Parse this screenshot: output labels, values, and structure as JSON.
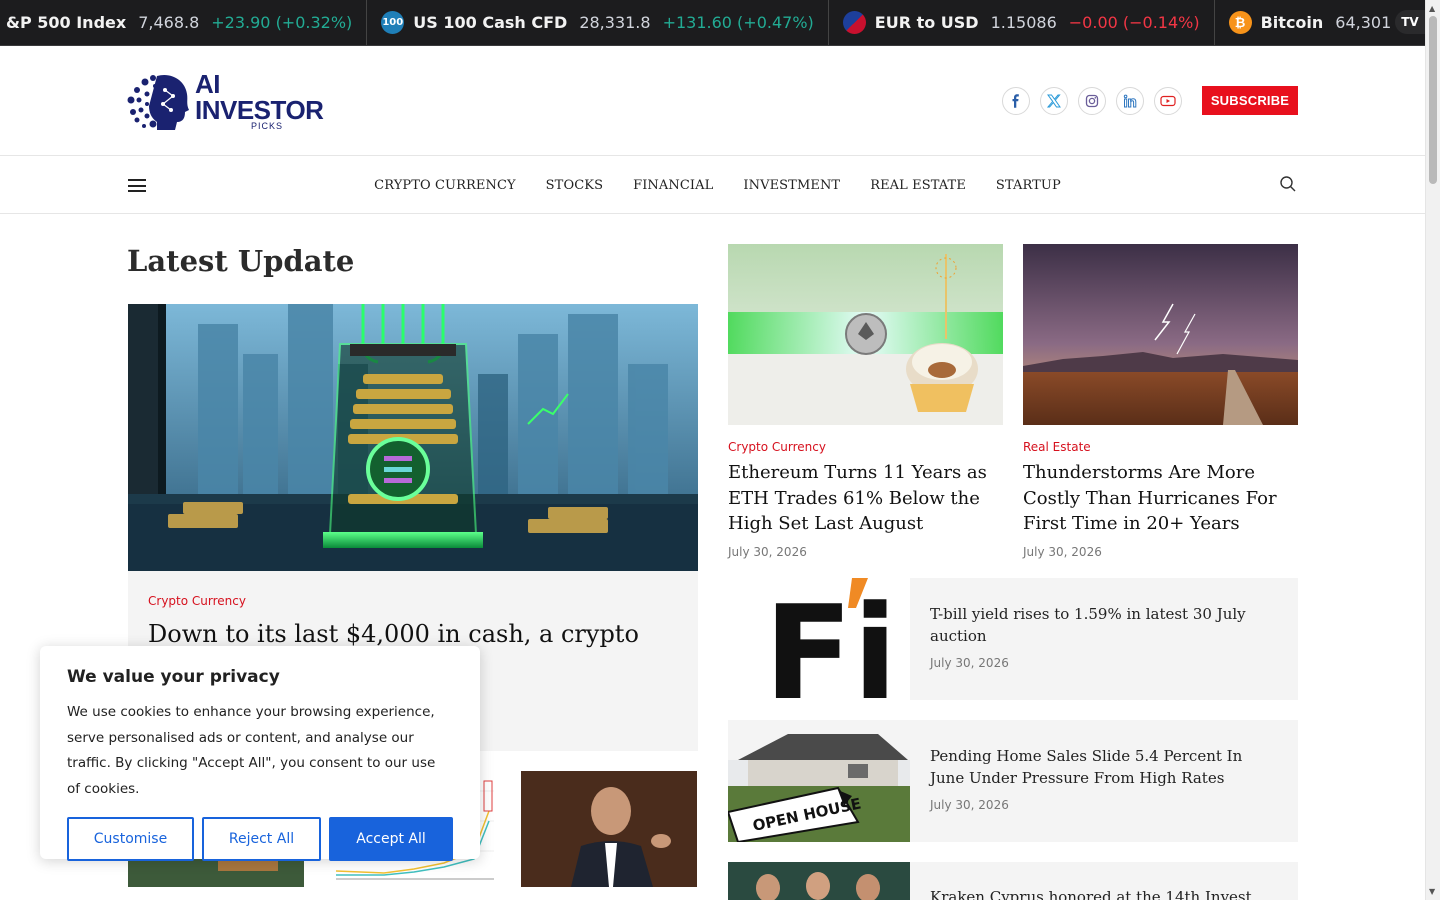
{
  "ticker": [
    {
      "name": "&P 500 Index",
      "price": "7,468.8",
      "change": "+23.90 (+0.32%)",
      "dir": "up",
      "icon": ""
    },
    {
      "name": "US 100 Cash CFD",
      "price": "28,331.8",
      "change": "+131.60 (+0.47%)",
      "dir": "up",
      "icon": "100"
    },
    {
      "name": "EUR to USD",
      "price": "1.15086",
      "change": "−0.00 (−0.14%)",
      "dir": "down",
      "icon": ""
    },
    {
      "name": "Bitcoin",
      "price": "64,301",
      "change": "−",
      "dir": "down",
      "icon": "₿"
    }
  ],
  "tv_logo": "TV",
  "logo": {
    "title": "AI INVESTOR",
    "sub": "PICKS"
  },
  "subscribe_label": "SUBSCRIBE",
  "nav": [
    "CRYPTO CURRENCY",
    "STOCKS",
    "FINANCIAL",
    "INVESTMENT",
    "REAL ESTATE",
    "STARTUP"
  ],
  "section_title": "Latest Update",
  "hero": {
    "category": "Crypto Currency",
    "title": "Down to its last $4,000 in cash, a crypto firm seeking a loan to"
  },
  "grid": [
    {
      "category": "Crypto Currency",
      "title": "Ethereum Turns 11 Years as ETH Trades 61% Below the High Set Last August",
      "date": "July 30, 2026"
    },
    {
      "category": "Real Estate",
      "title": "Thunderstorms Are More Costly Than Hurricanes For First Time in 20+ Years",
      "date": "July 30, 2026"
    }
  ],
  "list": [
    {
      "title": "T-bill yield rises to 1.59% in latest 30 July auction",
      "date": "July 30, 2026"
    },
    {
      "title": "Pending Home Sales Slide 5.4 Percent In June Under Pressure From High Rates",
      "date": "July 30, 2026"
    },
    {
      "title": "Kraken Cyprus honored at the 14th Invest",
      "date": ""
    }
  ],
  "fi_logo": "Fi",
  "open_house_sign": "OPEN HOUSE",
  "cookie": {
    "title": "We value your privacy",
    "text": "We use cookies to enhance your browsing experience, serve personalised ads or content, and analyse our traffic. By clicking \"Accept All\", you consent to our use of cookies.",
    "customise": "Customise",
    "reject": "Reject All",
    "accept": "Accept All"
  },
  "colors": {
    "accent": "#e8101d",
    "brand": "#1a2270",
    "cookie_blue": "#1863dc",
    "ticker_up": "#22ab94",
    "ticker_down": "#f23645"
  }
}
